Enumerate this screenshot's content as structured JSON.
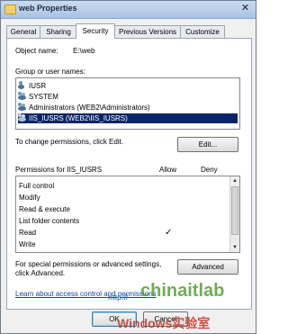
{
  "window": {
    "title": "web Properties",
    "close_label": "✕"
  },
  "tabs": [
    "General",
    "Sharing",
    "Security",
    "Previous Versions",
    "Customize"
  ],
  "object": {
    "label": "Object name:",
    "value": "E:\\web"
  },
  "groups": {
    "label": "Group or user names:",
    "items": [
      "IUSR",
      "SYSTEM",
      "Administrators (WEB2\\Administrators)",
      "IIS_IUSRS (WEB2\\IIS_IUSRS)"
    ],
    "selected_index": 3
  },
  "change_text": "To change permissions, click Edit.",
  "edit_label": "Edit...",
  "permissions": {
    "header": "Permissions for IIS_IUSRS",
    "allow_header": "Allow",
    "deny_header": "Deny",
    "rows": [
      {
        "name": "Full control",
        "allow": "",
        "deny": ""
      },
      {
        "name": "Modify",
        "allow": "",
        "deny": ""
      },
      {
        "name": "Read & execute",
        "allow": "",
        "deny": ""
      },
      {
        "name": "List folder contents",
        "allow": "",
        "deny": ""
      },
      {
        "name": "Read",
        "allow": "✓",
        "deny": ""
      },
      {
        "name": "Write",
        "allow": "",
        "deny": ""
      }
    ]
  },
  "advanced_text_1": "For special permissions or advanced settings,",
  "advanced_text_2": "click Advanced.",
  "advanced_label": "Advanced",
  "learn_link": "Learn about access control and permissions",
  "ok_label": "OK",
  "cancel_label": "Cancel",
  "watermark": {
    "top": "chinaitlab",
    "bottom": "Windows实验室",
    "url": "http://"
  }
}
